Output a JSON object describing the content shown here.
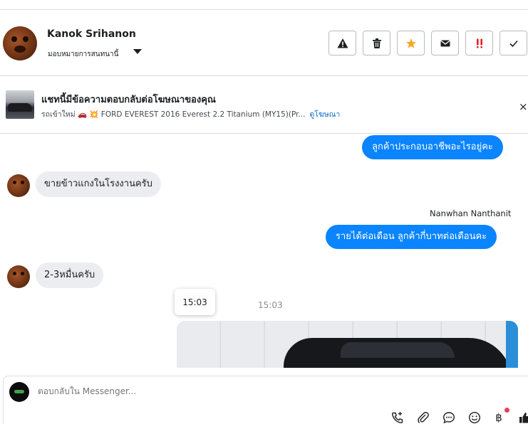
{
  "conversation": {
    "contact_name": "Kanok Srihanon",
    "assign_label": "มอบหมายการสนทนานี้"
  },
  "ad": {
    "title": "แชทนี้มีข้อความตอบกลับต่อโฆษณาของคุณ",
    "subtitle": "รถเข้าใหม่ 🚗 💥 FORD EVEREST 2016 Everest 2.2 Titanium (MY15)(Pr...",
    "link_label": "ดูโฆษณา",
    "close_glyph": "×"
  },
  "messages": {
    "out_1": "ลูกค้าประกอบอาชีพอะไรอยู่คะ",
    "in_1": "ขายข้าวแกงในโรงงานครับ",
    "sender_name": "Nanwhan Nanthanit",
    "out_2": "รายได้ต่อเดือน ลูกค้ากี่บาทต่อเดือนคะ",
    "in_2": "2-3หมื่นครับ",
    "tooltip_time": "15:03",
    "timestamp": "15:03"
  },
  "composer": {
    "placeholder": "ตอบกลับใน Messenger...",
    "baht_glyph": "฿"
  },
  "colors": {
    "accent_blue": "#0a84ff",
    "incoming_bubble": "#ebedf0",
    "star_orange": "#f5a623",
    "urgent_red": "#e02020"
  },
  "icons": {
    "actions": [
      "warning-icon",
      "trash-icon",
      "star-icon",
      "mail-icon",
      "double-exclamation-icon",
      "check-icon"
    ],
    "composer": [
      "add-call-icon",
      "paperclip-icon",
      "chat-bubble-icon",
      "smiley-icon",
      "baht-icon",
      "thumbs-up-icon"
    ]
  }
}
